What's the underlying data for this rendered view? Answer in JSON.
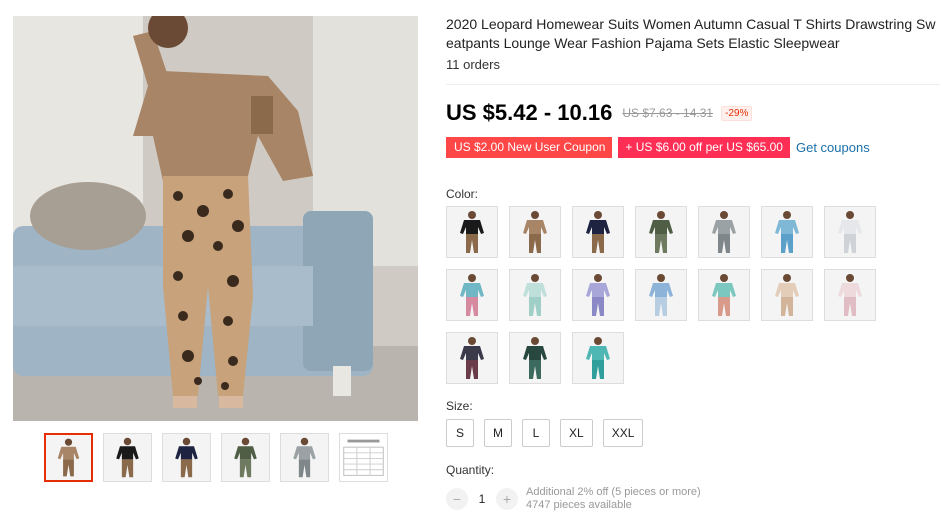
{
  "product": {
    "title": "2020 Leopard Homewear Suits Women Autumn Casual T Shirts Drawstring Sweatpants Lounge Wear Fashion Pajama Sets Elastic Sleepwear",
    "orders": "11 orders",
    "price": "US $5.42 - 10.16",
    "original_price": "US $7.63 - 14.31",
    "discount": "-29%"
  },
  "coupons": {
    "new_user": "US $2.00 New User Coupon",
    "store": "+ US $6.00 off per US $65.00",
    "get_coupons": "Get coupons"
  },
  "color": {
    "label": "Color:",
    "swatches": [
      {
        "name": "black-leopard",
        "top": "#1a1a1a",
        "bottom": "#8a6a4a"
      },
      {
        "name": "khaki-leopard",
        "top": "#a88566",
        "bottom": "#8a6a4a"
      },
      {
        "name": "navy-leopard",
        "top": "#1d2340",
        "bottom": "#8a6a4a"
      },
      {
        "name": "camo-green",
        "top": "#4f5e45",
        "bottom": "#6e7a5f"
      },
      {
        "name": "grey-camo",
        "top": "#9aa2a5",
        "bottom": "#7f878a"
      },
      {
        "name": "blue-tie-dye",
        "top": "#7fb8d6",
        "bottom": "#5aa0c8"
      },
      {
        "name": "white-floral",
        "top": "#e5e7ea",
        "bottom": "#cfd3d8"
      },
      {
        "name": "teal-pink-print",
        "top": "#6fb7c4",
        "bottom": "#d68aa0"
      },
      {
        "name": "mint-print",
        "top": "#bfe0da",
        "bottom": "#9fcfc6"
      },
      {
        "name": "lavender-print",
        "top": "#a8a6d8",
        "bottom": "#8b88c6"
      },
      {
        "name": "blue-floral-shorts",
        "top": "#8db4d8",
        "bottom": "#b7cde2"
      },
      {
        "name": "multicolor-shorts",
        "top": "#7cc8c0",
        "bottom": "#d89a8a"
      },
      {
        "name": "beige-floral-shorts",
        "top": "#e3cdb8",
        "bottom": "#d2b49a"
      },
      {
        "name": "white-pink-floral",
        "top": "#eed9dd",
        "bottom": "#e0bcc4"
      },
      {
        "name": "dark-floral",
        "top": "#3b3a4a",
        "bottom": "#6a3b48"
      },
      {
        "name": "dark-green-print",
        "top": "#27473f",
        "bottom": "#3d6a5e"
      },
      {
        "name": "turquoise-tie-dye",
        "top": "#4fb7b3",
        "bottom": "#2f9f9c"
      }
    ]
  },
  "size": {
    "label": "Size:",
    "options": [
      "S",
      "M",
      "L",
      "XL",
      "XXL"
    ]
  },
  "quantity": {
    "label": "Quantity:",
    "minus": "−",
    "plus": "+",
    "value": "1",
    "additional": "Additional 2% off (5 pieces or more)",
    "available": "4747 pieces available"
  },
  "gallery": {
    "thumbs": [
      {
        "name": "khaki-leopard-thumb",
        "top": "#a88566",
        "bottom": "#8a6a4a"
      },
      {
        "name": "black-leopard-thumb",
        "top": "#1a1a1a",
        "bottom": "#8a6a4a"
      },
      {
        "name": "navy-leopard-thumb",
        "top": "#1d2340",
        "bottom": "#8a6a4a"
      },
      {
        "name": "camo-thumb",
        "top": "#4f5e45",
        "bottom": "#6e7a5f"
      },
      {
        "name": "grey-camo-thumb",
        "top": "#9aa2a5",
        "bottom": "#7f878a"
      },
      {
        "name": "size-chart-thumb",
        "top": "#ffffff",
        "bottom": "#dddddd"
      }
    ]
  }
}
